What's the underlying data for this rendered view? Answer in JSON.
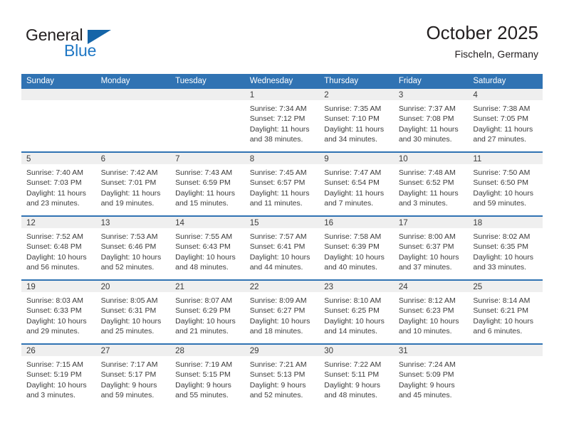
{
  "brand": {
    "name_top": "General",
    "name_bottom": "Blue",
    "accent_color": "#1f77c4",
    "triangle_color": "#1565a8"
  },
  "header": {
    "title": "October 2025",
    "subtitle": "Fischeln, Germany"
  },
  "theme": {
    "header_blue": "#3073b3",
    "date_strip_gray": "#efefef",
    "text_color": "#3b3b3b"
  },
  "calendar": {
    "day_headers": [
      "Sunday",
      "Monday",
      "Tuesday",
      "Wednesday",
      "Thursday",
      "Friday",
      "Saturday"
    ],
    "weeks": [
      [
        {
          "day": "",
          "lines": []
        },
        {
          "day": "",
          "lines": []
        },
        {
          "day": "",
          "lines": []
        },
        {
          "day": "1",
          "lines": [
            "Sunrise: 7:34 AM",
            "Sunset: 7:12 PM",
            "Daylight: 11 hours",
            "and 38 minutes."
          ]
        },
        {
          "day": "2",
          "lines": [
            "Sunrise: 7:35 AM",
            "Sunset: 7:10 PM",
            "Daylight: 11 hours",
            "and 34 minutes."
          ]
        },
        {
          "day": "3",
          "lines": [
            "Sunrise: 7:37 AM",
            "Sunset: 7:08 PM",
            "Daylight: 11 hours",
            "and 30 minutes."
          ]
        },
        {
          "day": "4",
          "lines": [
            "Sunrise: 7:38 AM",
            "Sunset: 7:05 PM",
            "Daylight: 11 hours",
            "and 27 minutes."
          ]
        }
      ],
      [
        {
          "day": "5",
          "lines": [
            "Sunrise: 7:40 AM",
            "Sunset: 7:03 PM",
            "Daylight: 11 hours",
            "and 23 minutes."
          ]
        },
        {
          "day": "6",
          "lines": [
            "Sunrise: 7:42 AM",
            "Sunset: 7:01 PM",
            "Daylight: 11 hours",
            "and 19 minutes."
          ]
        },
        {
          "day": "7",
          "lines": [
            "Sunrise: 7:43 AM",
            "Sunset: 6:59 PM",
            "Daylight: 11 hours",
            "and 15 minutes."
          ]
        },
        {
          "day": "8",
          "lines": [
            "Sunrise: 7:45 AM",
            "Sunset: 6:57 PM",
            "Daylight: 11 hours",
            "and 11 minutes."
          ]
        },
        {
          "day": "9",
          "lines": [
            "Sunrise: 7:47 AM",
            "Sunset: 6:54 PM",
            "Daylight: 11 hours",
            "and 7 minutes."
          ]
        },
        {
          "day": "10",
          "lines": [
            "Sunrise: 7:48 AM",
            "Sunset: 6:52 PM",
            "Daylight: 11 hours",
            "and 3 minutes."
          ]
        },
        {
          "day": "11",
          "lines": [
            "Sunrise: 7:50 AM",
            "Sunset: 6:50 PM",
            "Daylight: 10 hours",
            "and 59 minutes."
          ]
        }
      ],
      [
        {
          "day": "12",
          "lines": [
            "Sunrise: 7:52 AM",
            "Sunset: 6:48 PM",
            "Daylight: 10 hours",
            "and 56 minutes."
          ]
        },
        {
          "day": "13",
          "lines": [
            "Sunrise: 7:53 AM",
            "Sunset: 6:46 PM",
            "Daylight: 10 hours",
            "and 52 minutes."
          ]
        },
        {
          "day": "14",
          "lines": [
            "Sunrise: 7:55 AM",
            "Sunset: 6:43 PM",
            "Daylight: 10 hours",
            "and 48 minutes."
          ]
        },
        {
          "day": "15",
          "lines": [
            "Sunrise: 7:57 AM",
            "Sunset: 6:41 PM",
            "Daylight: 10 hours",
            "and 44 minutes."
          ]
        },
        {
          "day": "16",
          "lines": [
            "Sunrise: 7:58 AM",
            "Sunset: 6:39 PM",
            "Daylight: 10 hours",
            "and 40 minutes."
          ]
        },
        {
          "day": "17",
          "lines": [
            "Sunrise: 8:00 AM",
            "Sunset: 6:37 PM",
            "Daylight: 10 hours",
            "and 37 minutes."
          ]
        },
        {
          "day": "18",
          "lines": [
            "Sunrise: 8:02 AM",
            "Sunset: 6:35 PM",
            "Daylight: 10 hours",
            "and 33 minutes."
          ]
        }
      ],
      [
        {
          "day": "19",
          "lines": [
            "Sunrise: 8:03 AM",
            "Sunset: 6:33 PM",
            "Daylight: 10 hours",
            "and 29 minutes."
          ]
        },
        {
          "day": "20",
          "lines": [
            "Sunrise: 8:05 AM",
            "Sunset: 6:31 PM",
            "Daylight: 10 hours",
            "and 25 minutes."
          ]
        },
        {
          "day": "21",
          "lines": [
            "Sunrise: 8:07 AM",
            "Sunset: 6:29 PM",
            "Daylight: 10 hours",
            "and 21 minutes."
          ]
        },
        {
          "day": "22",
          "lines": [
            "Sunrise: 8:09 AM",
            "Sunset: 6:27 PM",
            "Daylight: 10 hours",
            "and 18 minutes."
          ]
        },
        {
          "day": "23",
          "lines": [
            "Sunrise: 8:10 AM",
            "Sunset: 6:25 PM",
            "Daylight: 10 hours",
            "and 14 minutes."
          ]
        },
        {
          "day": "24",
          "lines": [
            "Sunrise: 8:12 AM",
            "Sunset: 6:23 PM",
            "Daylight: 10 hours",
            "and 10 minutes."
          ]
        },
        {
          "day": "25",
          "lines": [
            "Sunrise: 8:14 AM",
            "Sunset: 6:21 PM",
            "Daylight: 10 hours",
            "and 6 minutes."
          ]
        }
      ],
      [
        {
          "day": "26",
          "lines": [
            "Sunrise: 7:15 AM",
            "Sunset: 5:19 PM",
            "Daylight: 10 hours",
            "and 3 minutes."
          ]
        },
        {
          "day": "27",
          "lines": [
            "Sunrise: 7:17 AM",
            "Sunset: 5:17 PM",
            "Daylight: 9 hours",
            "and 59 minutes."
          ]
        },
        {
          "day": "28",
          "lines": [
            "Sunrise: 7:19 AM",
            "Sunset: 5:15 PM",
            "Daylight: 9 hours",
            "and 55 minutes."
          ]
        },
        {
          "day": "29",
          "lines": [
            "Sunrise: 7:21 AM",
            "Sunset: 5:13 PM",
            "Daylight: 9 hours",
            "and 52 minutes."
          ]
        },
        {
          "day": "30",
          "lines": [
            "Sunrise: 7:22 AM",
            "Sunset: 5:11 PM",
            "Daylight: 9 hours",
            "and 48 minutes."
          ]
        },
        {
          "day": "31",
          "lines": [
            "Sunrise: 7:24 AM",
            "Sunset: 5:09 PM",
            "Daylight: 9 hours",
            "and 45 minutes."
          ]
        },
        {
          "day": "",
          "lines": []
        }
      ]
    ]
  }
}
